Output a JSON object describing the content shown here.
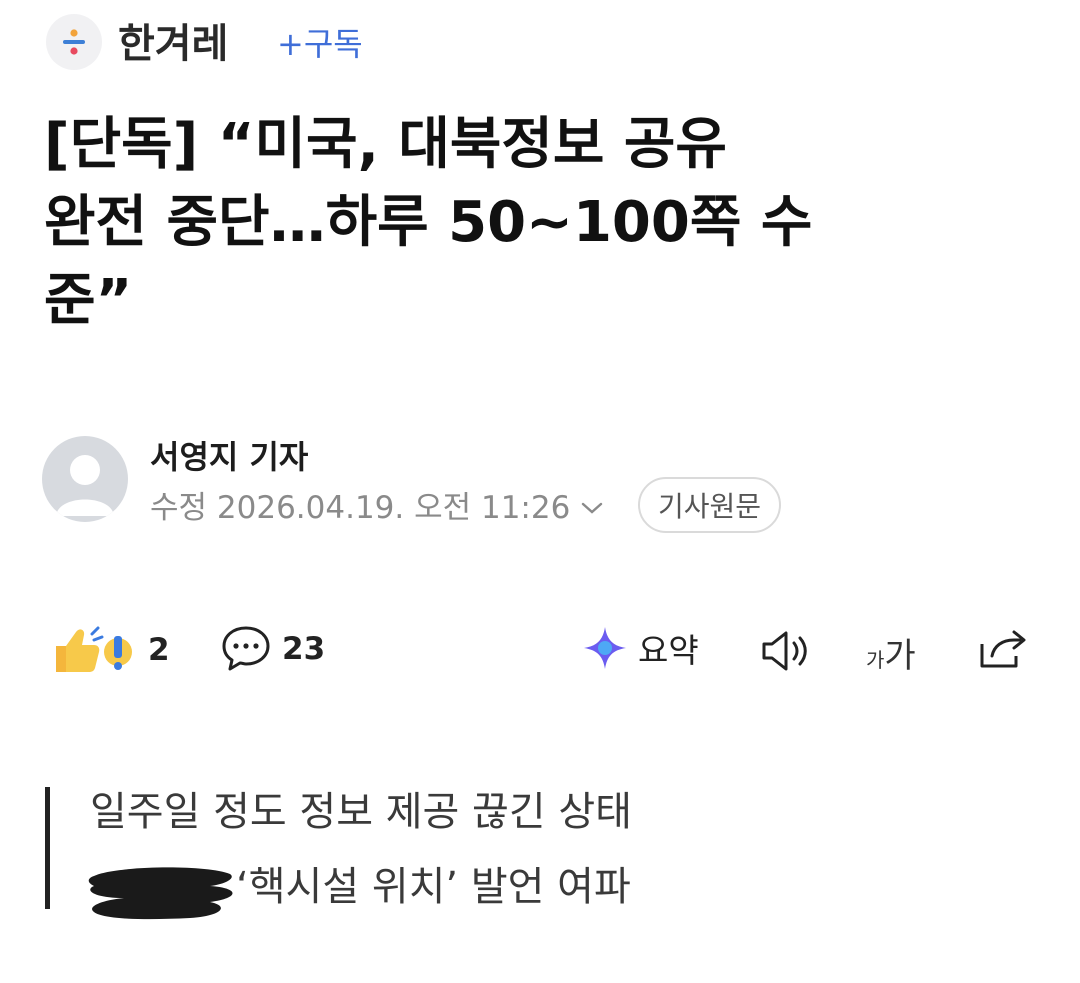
{
  "publisher": {
    "name": "한겨레",
    "subscribe_label": "+구독"
  },
  "article": {
    "headline_lines": [
      "[단독] “미국, 대북정보 공유",
      "완전 중단…하루 50~100쪽 수",
      "준”"
    ],
    "reporter": "서영지 기자",
    "updated_label": "수정 2026.04.19. 오전 11:26",
    "original_button": "기사원문",
    "subtitle_lines": [
      "일주일 정도 정보 제공 끊긴 상태",
      "‘핵시설 위치’ 발언 여파"
    ]
  },
  "actions": {
    "reaction_count": "2",
    "comment_count": "23",
    "summary_label": "요약",
    "font_size_label_small": "가",
    "font_size_label_large": "가"
  },
  "colors": {
    "accent_blue": "#3f6ed8",
    "summary_purple": "#6b5cf0"
  }
}
